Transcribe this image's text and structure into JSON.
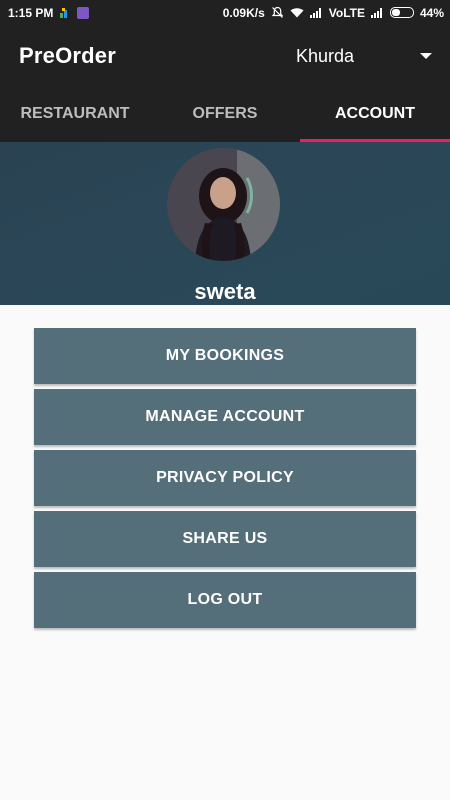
{
  "status_bar": {
    "time": "1:15 PM",
    "network_speed": "0.09K/s",
    "carrier": "VoLTE",
    "battery_percent": "44%",
    "battery_level": 0.44,
    "icons": [
      "app-icon",
      "app-icon",
      "mute-icon",
      "wifi-icon",
      "signal-icon",
      "signal-icon",
      "battery-icon"
    ]
  },
  "app_bar": {
    "title": "PreOrder",
    "location": "Khurda"
  },
  "tabs": [
    {
      "label": "RESTAURANT",
      "active": false
    },
    {
      "label": "OFFERS",
      "active": false
    },
    {
      "label": "ACCOUNT",
      "active": true
    }
  ],
  "profile": {
    "name": "sweta"
  },
  "menu": {
    "items": [
      {
        "label": "MY BOOKINGS"
      },
      {
        "label": "MANAGE ACCOUNT"
      },
      {
        "label": "PRIVACY POLICY"
      },
      {
        "label": "SHARE US"
      },
      {
        "label": "LOG OUT"
      }
    ]
  },
  "colors": {
    "bar_background": "#212121",
    "accent": "#e91e63",
    "header_background": "#2b4757",
    "button_background": "#546e7a"
  }
}
